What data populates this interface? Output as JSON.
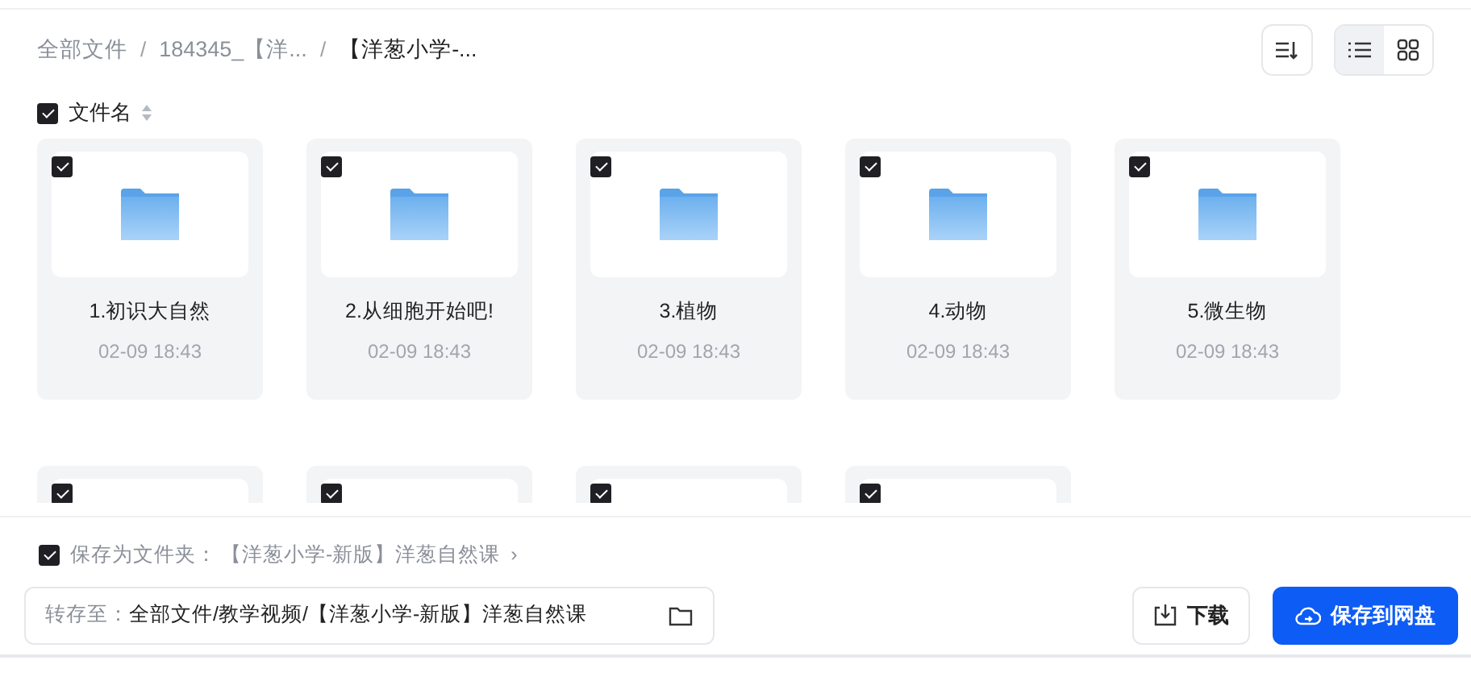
{
  "breadcrumb": [
    {
      "label": "全部文件",
      "current": false
    },
    {
      "separator": "/",
      "label": "184345_【洋...",
      "current": false
    },
    {
      "separator": "/",
      "label": "【洋葱小学-...",
      "current": true
    }
  ],
  "view_modes": [
    {
      "kind": "list",
      "selected": true
    },
    {
      "kind": "grid",
      "selected": false
    }
  ],
  "header": {
    "label": "文件名",
    "checked": true
  },
  "files": [
    {
      "name": "1.初识大自然",
      "time": "02-09 18:43",
      "checked": true
    },
    {
      "name": "2.从细胞开始吧!",
      "time": "02-09 18:43",
      "checked": true
    },
    {
      "name": "3.植物",
      "time": "02-09 18:43",
      "checked": true
    },
    {
      "name": "4.动物",
      "time": "02-09 18:43",
      "checked": true
    },
    {
      "name": "5.微生物",
      "time": "02-09 18:43",
      "checked": true
    },
    {
      "checked": true
    },
    {
      "checked": true
    },
    {
      "checked": true
    },
    {
      "checked": true
    }
  ],
  "save_as_folder": {
    "checked": true,
    "label": "保存为文件夹：",
    "folder": "【洋葱小学-新版】洋葱自然课",
    "chevron": "›"
  },
  "destination": {
    "label": "转存至：",
    "value": "全部文件/教学视频/【洋葱小学-新版】洋葱自然课"
  },
  "buttons": [
    {
      "kind": "download",
      "label": "下载"
    },
    {
      "kind": "save",
      "label": "保存到网盘"
    }
  ]
}
